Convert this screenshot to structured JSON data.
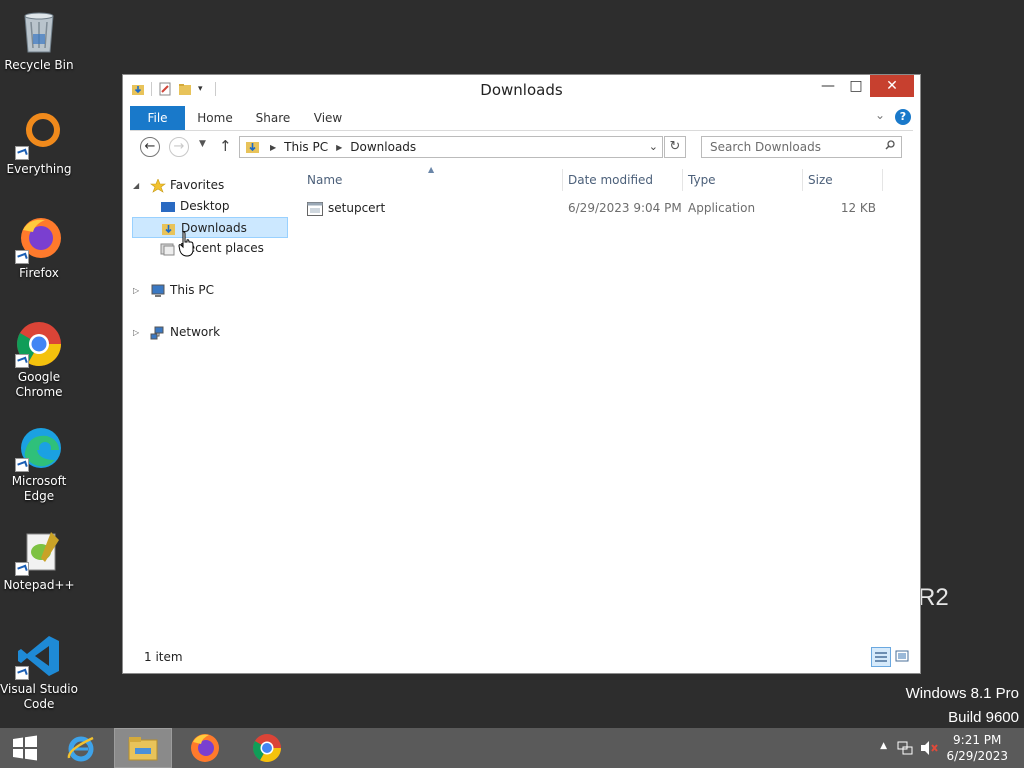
{
  "desktop": {
    "icons": [
      {
        "label": "Recycle Bin",
        "icon": "recycle-bin-icon"
      },
      {
        "label": "Everything",
        "icon": "everything-icon"
      },
      {
        "label": "Firefox",
        "icon": "firefox-icon"
      },
      {
        "label": "Google\nChrome",
        "icon": "chrome-icon"
      },
      {
        "label": "Microsoft\nEdge",
        "icon": "edge-icon"
      },
      {
        "label": "Notepad++",
        "icon": "notepadpp-icon"
      },
      {
        "label": "Visual Studio\nCode",
        "icon": "vscode-icon"
      }
    ],
    "watermark": {
      "edition": "Windows 8.1 Pro",
      "build": "Build 9600",
      "partial": "R2"
    }
  },
  "window": {
    "title": "Downloads",
    "ribbon_tabs": [
      "File",
      "Home",
      "Share",
      "View"
    ],
    "help_label": "?",
    "breadcrumb": [
      "This PC",
      "Downloads"
    ],
    "search_placeholder": "Search Downloads",
    "nav": {
      "favorites": "Favorites",
      "desktop": "Desktop",
      "downloads": "Downloads",
      "recent": "Recent places",
      "this_pc": "This PC",
      "network": "Network"
    },
    "columns": {
      "name": "Name",
      "date": "Date modified",
      "type": "Type",
      "size": "Size"
    },
    "files": [
      {
        "name": "setupcert",
        "date": "6/29/2023 9:04 PM",
        "type": "Application",
        "size": "12 KB"
      }
    ],
    "status": "1 item"
  },
  "taskbar": {
    "time": "9:21 PM",
    "date": "6/29/2023"
  },
  "colors": {
    "accent": "#1979ca",
    "close": "#c7402f",
    "selection": "#cce8ff"
  }
}
